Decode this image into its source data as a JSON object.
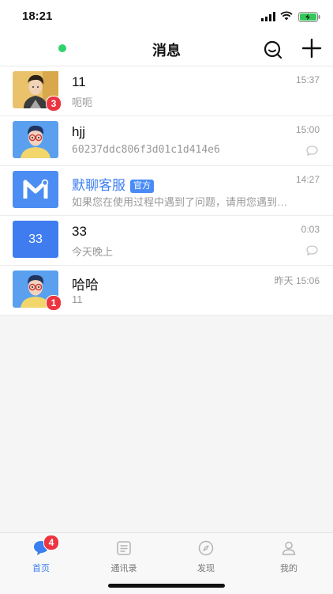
{
  "status": {
    "time": "18:21"
  },
  "header": {
    "title": "消息"
  },
  "conversations": [
    {
      "name": "11",
      "preview": "呃呃",
      "time": "15:37",
      "badge": "3",
      "avatar": "photo-avatar-icon"
    },
    {
      "name": "hjj",
      "preview": "60237ddc806f3d01c1d414e6",
      "time": "15:00",
      "avatar": "cartoon-man-avatar-icon"
    },
    {
      "name": "默聊客服",
      "tag": "官方",
      "preview": "如果您在使用过程中遇到了问题，请用您遇到的问题描述",
      "time": "14:27",
      "avatar": "m-logo-avatar-icon"
    },
    {
      "name": "33",
      "preview": "今天晚上",
      "time": "0:03",
      "avatar_text": "33"
    },
    {
      "name": "哈哈",
      "preview": "11",
      "time": "昨天 15:06",
      "badge": "1",
      "avatar": "cartoon-man-avatar-icon"
    }
  ],
  "tabbar": {
    "tabs": [
      {
        "label": "首页",
        "icon": "chat-bubble-icon",
        "badge": "4",
        "active": true
      },
      {
        "label": "通讯录",
        "icon": "contacts-icon"
      },
      {
        "label": "发现",
        "icon": "compass-icon"
      },
      {
        "label": "我的",
        "icon": "person-icon"
      }
    ]
  },
  "colors": {
    "accent": "#3a7ef0",
    "badge": "#ec3541",
    "online": "#2fd36b"
  }
}
